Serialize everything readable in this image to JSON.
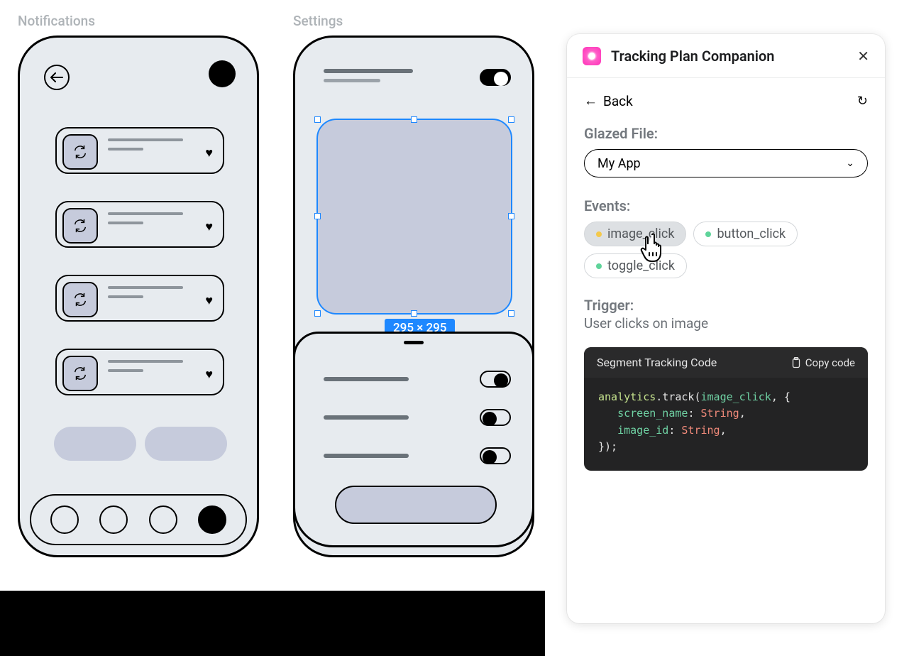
{
  "mockups": {
    "notifications_label": "Notifications",
    "settings_label": "Settings",
    "selection_dim": "295 × 295"
  },
  "panel": {
    "title": "Tracking Plan Companion",
    "back_label": "Back",
    "file_label": "Glazed File:",
    "file_value": "My App",
    "events_label": "Events:",
    "events": [
      {
        "name": "image_click",
        "color": "yellow",
        "active": true
      },
      {
        "name": "button_click",
        "color": "green",
        "active": false
      },
      {
        "name": "toggle_click",
        "color": "green",
        "active": false
      }
    ],
    "trigger_label": "Trigger:",
    "trigger_text": "User clicks on image",
    "code_title": "Segment Tracking Code",
    "copy_label": "Copy code",
    "code": {
      "obj": "analytics",
      "method": ".track(",
      "event": "image_click",
      "after_event": ", {",
      "prop1": "screen_name",
      "prop2": "image_id",
      "type": "String",
      "close": "});"
    }
  }
}
